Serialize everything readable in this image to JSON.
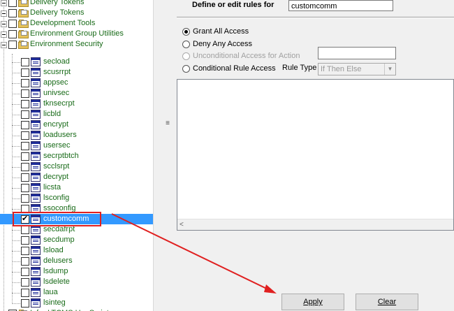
{
  "tree": {
    "folders": [
      {
        "label": "Delivery Tokens"
      },
      {
        "label": "Delivery Tokens"
      },
      {
        "label": "Development Tools"
      },
      {
        "label": "Environment Group Utilities"
      },
      {
        "label": "Environment Security"
      }
    ],
    "items": [
      {
        "label": "secload",
        "checked": false,
        "selected": false
      },
      {
        "label": "scusrrpt",
        "checked": false,
        "selected": false
      },
      {
        "label": "appsec",
        "checked": false,
        "selected": false
      },
      {
        "label": "univsec",
        "checked": false,
        "selected": false
      },
      {
        "label": "tknsecrpt",
        "checked": false,
        "selected": false
      },
      {
        "label": "licbld",
        "checked": false,
        "selected": false
      },
      {
        "label": "encrypt",
        "checked": false,
        "selected": false
      },
      {
        "label": "loadusers",
        "checked": false,
        "selected": false
      },
      {
        "label": "usersec",
        "checked": false,
        "selected": false
      },
      {
        "label": "secrptbtch",
        "checked": false,
        "selected": false
      },
      {
        "label": "scclsrpt",
        "checked": false,
        "selected": false
      },
      {
        "label": "decrypt",
        "checked": false,
        "selected": false
      },
      {
        "label": "licsta",
        "checked": false,
        "selected": false
      },
      {
        "label": "lsconfig",
        "checked": false,
        "selected": false
      },
      {
        "label": "ssoconfig",
        "checked": false,
        "selected": false
      },
      {
        "label": "customcomm",
        "checked": true,
        "selected": true
      },
      {
        "label": "secdafrpt",
        "checked": false,
        "selected": false
      },
      {
        "label": "secdump",
        "checked": false,
        "selected": false
      },
      {
        "label": "lsload",
        "checked": false,
        "selected": false
      },
      {
        "label": "delusers",
        "checked": false,
        "selected": false
      },
      {
        "label": "lsdump",
        "checked": false,
        "selected": false
      },
      {
        "label": "lsdelete",
        "checked": false,
        "selected": false
      },
      {
        "label": "laua",
        "checked": false,
        "selected": false
      },
      {
        "label": "lsinteg",
        "checked": false,
        "selected": false
      }
    ],
    "bottom_partial": {
      "label": "Infor LTCMS Hsr Script"
    }
  },
  "form": {
    "define_label": "Define or edit rules for",
    "rule_target": "customcomm",
    "options": [
      {
        "label": "Grant All Access",
        "selected": true,
        "disabled": false
      },
      {
        "label": "Deny Any Access",
        "selected": false,
        "disabled": false
      },
      {
        "label": "Unconditional Access for Action",
        "selected": false,
        "disabled": true
      },
      {
        "label": "Conditional Rule Access",
        "selected": false,
        "disabled": false
      }
    ],
    "rule_type_label": "Rule Type",
    "rule_type_value": "If Then Else",
    "unconditional_value": ""
  },
  "buttons": {
    "apply": "Apply",
    "clear": "Clear"
  },
  "colors": {
    "selection": "#3399ff",
    "tree_text": "#196b19",
    "annotation": "#e02020"
  },
  "icons": [
    "folder-icon",
    "document-icon",
    "checkbox",
    "expander-minus",
    "splitter-grip-icon",
    "scroll-left-arrow-icon"
  ]
}
